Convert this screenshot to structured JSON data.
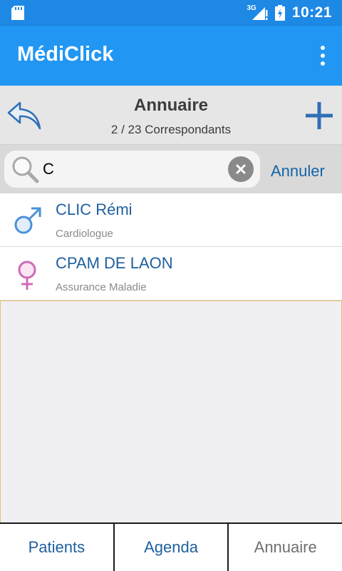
{
  "status_bar": {
    "network": "3G",
    "time": "10:21"
  },
  "app_bar": {
    "title": "MédiClick"
  },
  "header": {
    "title": "Annuaire",
    "subtitle": "2 / 23 Correspondants"
  },
  "search": {
    "value": "C",
    "cancel_label": "Annuler"
  },
  "contacts": [
    {
      "name": "CLIC Rémi",
      "role": "Cardiologue",
      "gender": "male",
      "icon": "male-symbol-icon",
      "color": "#4a90d9"
    },
    {
      "name": "CPAM DE LAON",
      "role": "Assurance Maladie",
      "gender": "female",
      "icon": "female-symbol-icon",
      "color": "#d16ab6"
    }
  ],
  "tabs": [
    {
      "label": "Patients",
      "active": false
    },
    {
      "label": "Agenda",
      "active": false
    },
    {
      "label": "Annuaire",
      "active": true
    }
  ],
  "colors": {
    "status_bar": "#1e88e5",
    "app_bar": "#2196f3",
    "link": "#1e5f9e"
  }
}
